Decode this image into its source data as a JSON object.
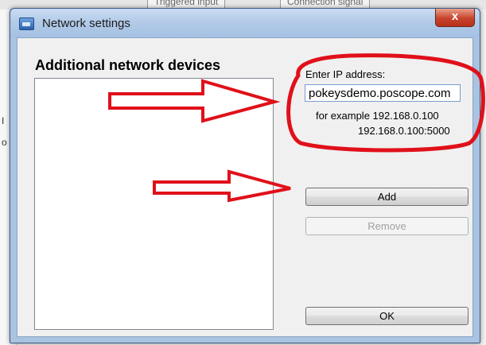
{
  "background": {
    "tabs": [
      "Triggered input",
      "Connection signal"
    ],
    "left_marks": [
      "I",
      "o"
    ]
  },
  "window": {
    "title": "Network settings",
    "close_label": "x"
  },
  "dialog": {
    "heading": "Additional network devices",
    "devices": [],
    "ip_label": "Enter IP address:",
    "ip_value": "pokeysdemo.poscope.com",
    "example_line1": "for example 192.168.0.100",
    "example_line2": "192.168.0.100:5000",
    "add_label": "Add",
    "remove_label": "Remove",
    "ok_label": "OK"
  },
  "annotations": {
    "color": "#e0101a",
    "arrow_count": 2,
    "ellipse_count": 1
  }
}
